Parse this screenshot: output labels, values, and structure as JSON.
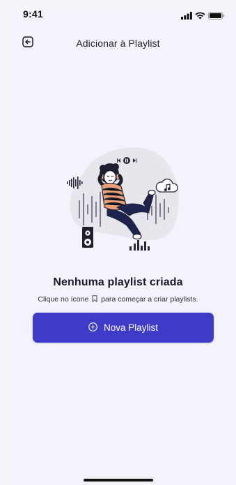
{
  "status_bar": {
    "time": "9:41",
    "icons": [
      "signal-icon",
      "wifi-icon",
      "battery-icon"
    ]
  },
  "header": {
    "title": "Adicionar à Playlist",
    "back_icon": "back-arrow-icon"
  },
  "empty_state": {
    "title": "Nenhuma playlist criada",
    "subtitle_before": "Clique no ícone",
    "subtitle_icon": "bookmark-icon",
    "subtitle_after": "para começar a criar playlists."
  },
  "actions": {
    "new_playlist_label": "Nova Playlist",
    "new_playlist_icon": "plus-circle-icon"
  },
  "colors": {
    "background": "#f4f4fb",
    "accent": "#3f3bc9",
    "illustration_blob": "#e6e6ec",
    "figure_sweater": "#e8a07a",
    "figure_pants": "#1e2350"
  }
}
